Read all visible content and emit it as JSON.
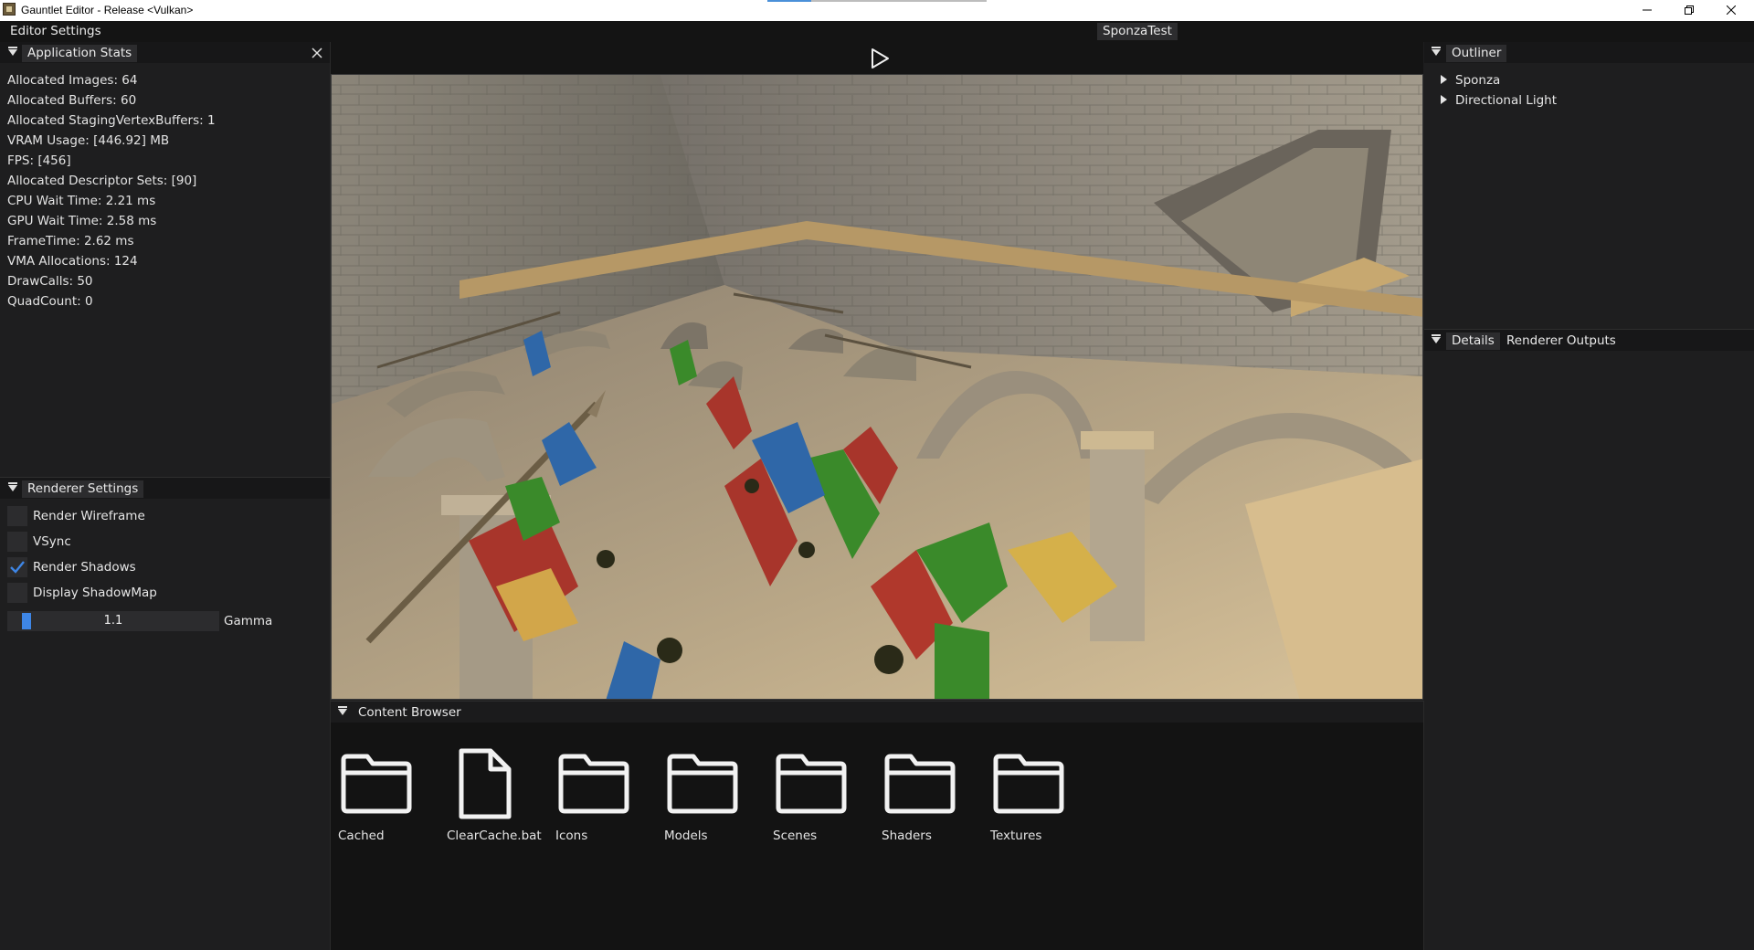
{
  "window": {
    "title": "Gauntlet Editor - Release <Vulkan>",
    "controls": [
      "minimize-icon",
      "restore-icon",
      "close-icon"
    ]
  },
  "menubar": {
    "editor_settings": "Editor Settings",
    "scene_tab": "SponzaTest"
  },
  "application_stats": {
    "title": "Application Stats",
    "close_icon": "close-icon",
    "lines": [
      "Allocated Images: 64",
      "Allocated Buffers: 60",
      "Allocated StagingVertexBuffers: 1",
      "VRAM Usage: [446.92] MB",
      "FPS: [456]",
      "Allocated Descriptor Sets: [90]",
      "CPU Wait Time: 2.21 ms",
      "GPU Wait Time: 2.58 ms",
      "FrameTime: 2.62 ms",
      "VMA Allocations: 124",
      "DrawCalls: 50",
      "QuadCount: 0"
    ]
  },
  "renderer_settings": {
    "title": "Renderer Settings",
    "options": [
      {
        "label": "Render Wireframe",
        "checked": false
      },
      {
        "label": "VSync",
        "checked": false
      },
      {
        "label": "Render Shadows",
        "checked": true
      },
      {
        "label": "Display ShadowMap",
        "checked": false
      }
    ],
    "gamma": {
      "label": "Gamma",
      "value": "1.1",
      "range": [
        1.0,
        3.0
      ]
    }
  },
  "viewport": {
    "play_icon": "play-icon"
  },
  "content_browser": {
    "title": "Content Browser",
    "items": [
      {
        "label": "Cached",
        "icon": "folder-icon"
      },
      {
        "label": "ClearCache.bat",
        "icon": "file-icon"
      },
      {
        "label": "Icons",
        "icon": "folder-icon"
      },
      {
        "label": "Models",
        "icon": "folder-icon"
      },
      {
        "label": "Scenes",
        "icon": "folder-icon"
      },
      {
        "label": "Shaders",
        "icon": "folder-icon"
      },
      {
        "label": "Textures",
        "icon": "folder-icon"
      }
    ]
  },
  "outliner": {
    "title": "Outliner",
    "items": [
      "Sponza",
      "Directional Light"
    ]
  },
  "details": {
    "tabs": [
      "Details",
      "Renderer Outputs"
    ]
  },
  "colors": {
    "accent": "#3e86e6",
    "panel_bg": "#1e1e1f",
    "header_bg": "#171718",
    "tab_bg": "#2c2c2e"
  }
}
